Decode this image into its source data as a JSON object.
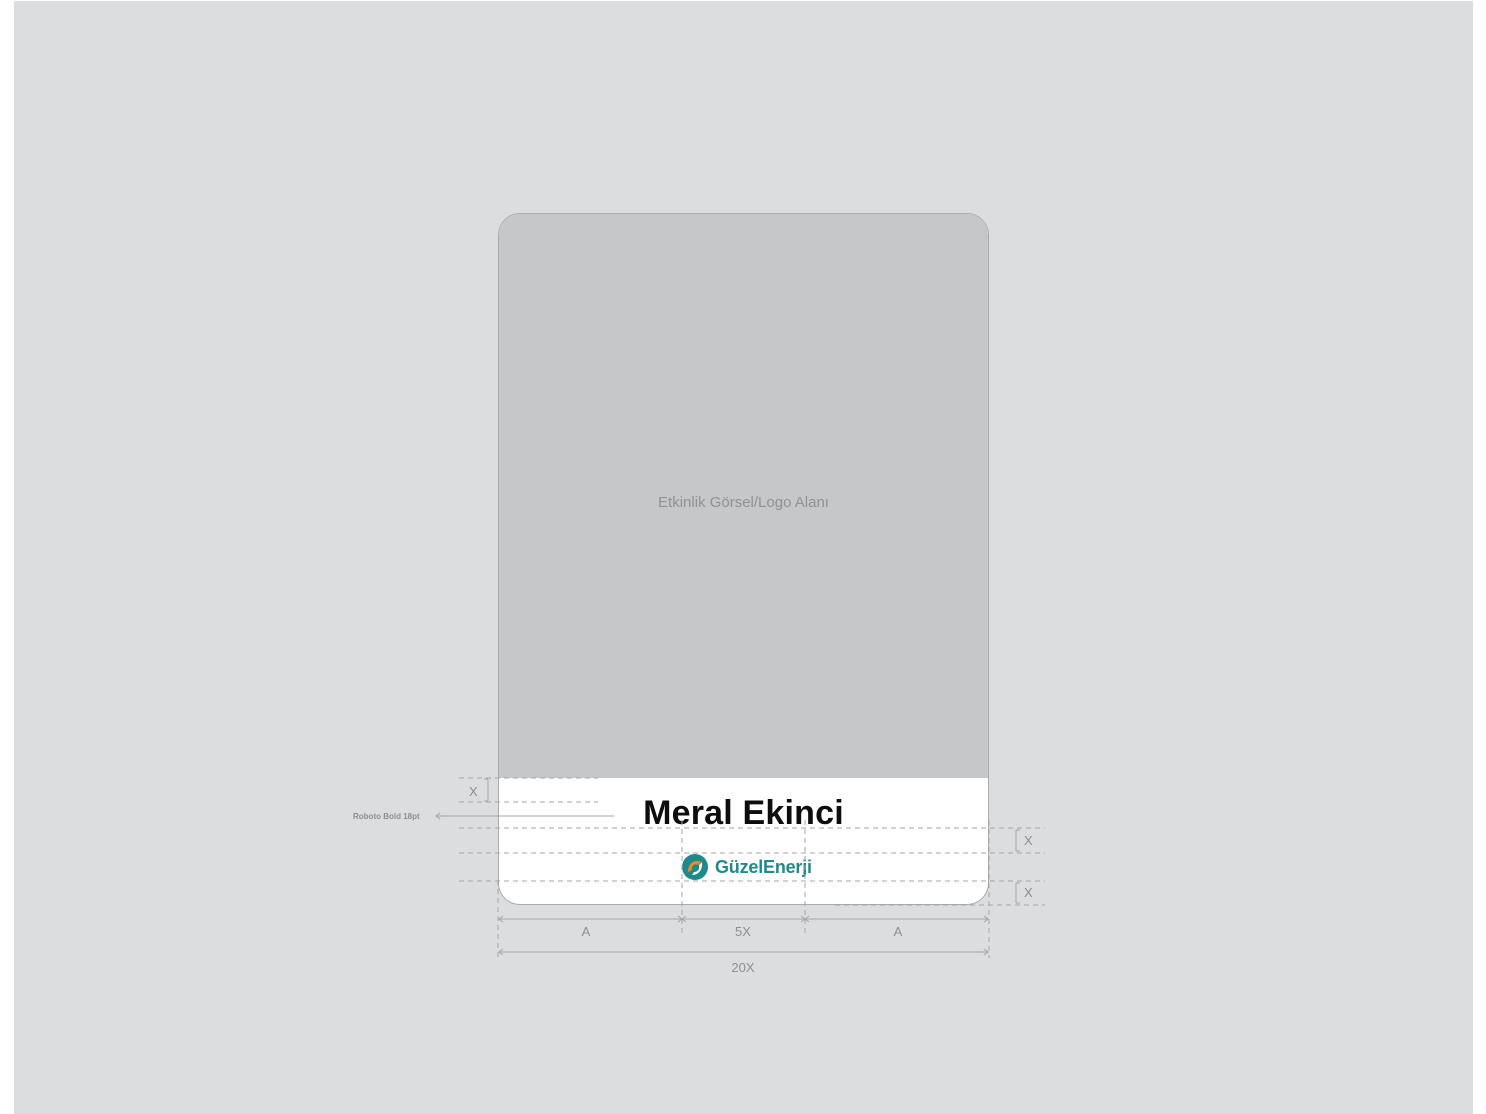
{
  "card": {
    "image_area_label": "Etkinlik Görsel/Logo Alanı",
    "name": "Meral Ekinci",
    "logo": {
      "icon": "guzelenerji-logo-icon",
      "text": "GüzelEnerji",
      "colors": {
        "teal": "#1f8a8c",
        "orange": "#f08a24"
      }
    }
  },
  "annotations": {
    "font_spec": "Roboto Bold 18pt"
  },
  "dimensions": {
    "x_label": "X",
    "left_margin": "A",
    "logo_width": "5X",
    "right_margin": "A",
    "total_width": "20X"
  },
  "colors": {
    "background": "#dcdddf",
    "image_area": "#c6c7c9",
    "guide": "#a3a5a8"
  }
}
